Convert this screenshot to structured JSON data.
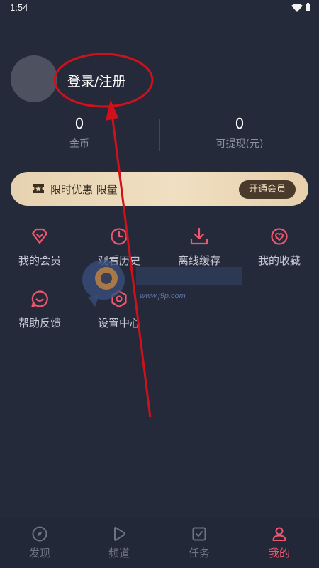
{
  "status_bar": {
    "time": "1:54"
  },
  "profile": {
    "login_label": "登录/注册"
  },
  "stats": {
    "coins": {
      "value": "0",
      "label": "金币"
    },
    "cash": {
      "value": "0",
      "label": "可提现(元)"
    }
  },
  "vip_banner": {
    "text": "限时优惠 限量",
    "button_label": "开通会员"
  },
  "menu": [
    {
      "label": "我的会员",
      "icon": "diamond-icon"
    },
    {
      "label": "观看历史",
      "icon": "clock-icon"
    },
    {
      "label": "离线缓存",
      "icon": "download-icon"
    },
    {
      "label": "我的收藏",
      "icon": "heart-icon"
    },
    {
      "label": "帮助反馈",
      "icon": "feedback-icon"
    },
    {
      "label": "设置中心",
      "icon": "settings-icon"
    }
  ],
  "watermark": {
    "url": "www.j9p.com"
  },
  "bottom_nav": [
    {
      "label": "发现",
      "icon": "compass-icon",
      "active": false
    },
    {
      "label": "频道",
      "icon": "play-icon",
      "active": false
    },
    {
      "label": "任务",
      "icon": "task-icon",
      "active": false
    },
    {
      "label": "我的",
      "icon": "user-icon",
      "active": true
    }
  ],
  "colors": {
    "accent": "#f0576d",
    "background": "#252a3a",
    "vip_gold": "#e6d2b0",
    "annotation_red": "#d0101a"
  }
}
